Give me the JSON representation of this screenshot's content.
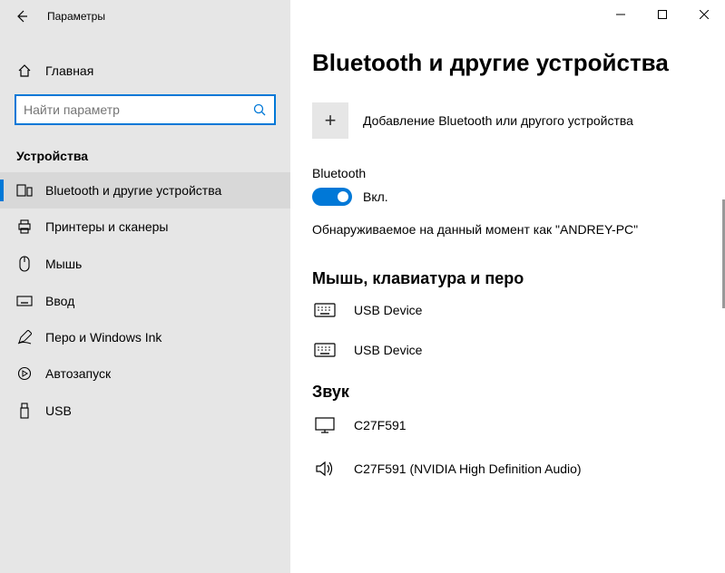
{
  "window": {
    "title": "Параметры"
  },
  "sidebar": {
    "home": "Главная",
    "search_placeholder": "Найти параметр",
    "section": "Устройства",
    "items": [
      {
        "label": "Bluetooth и другие устройства"
      },
      {
        "label": "Принтеры и сканеры"
      },
      {
        "label": "Мышь"
      },
      {
        "label": "Ввод"
      },
      {
        "label": "Перо и Windows Ink"
      },
      {
        "label": "Автозапуск"
      },
      {
        "label": "USB"
      }
    ]
  },
  "main": {
    "heading": "Bluetooth и другие устройства",
    "add_device": "Добавление Bluetooth или другого устройства",
    "bt_label": "Bluetooth",
    "bt_state": "Вкл.",
    "discoverable": "Обнаруживаемое на данный момент как \"ANDREY-PC\"",
    "section_mouse": "Мышь, клавиатура и перо",
    "mouse_devices": [
      {
        "name": "USB Device"
      },
      {
        "name": "USB Device"
      }
    ],
    "section_sound": "Звук",
    "sound_devices": [
      {
        "name": "C27F591"
      },
      {
        "name": "C27F591 (NVIDIA High Definition Audio)"
      }
    ]
  }
}
